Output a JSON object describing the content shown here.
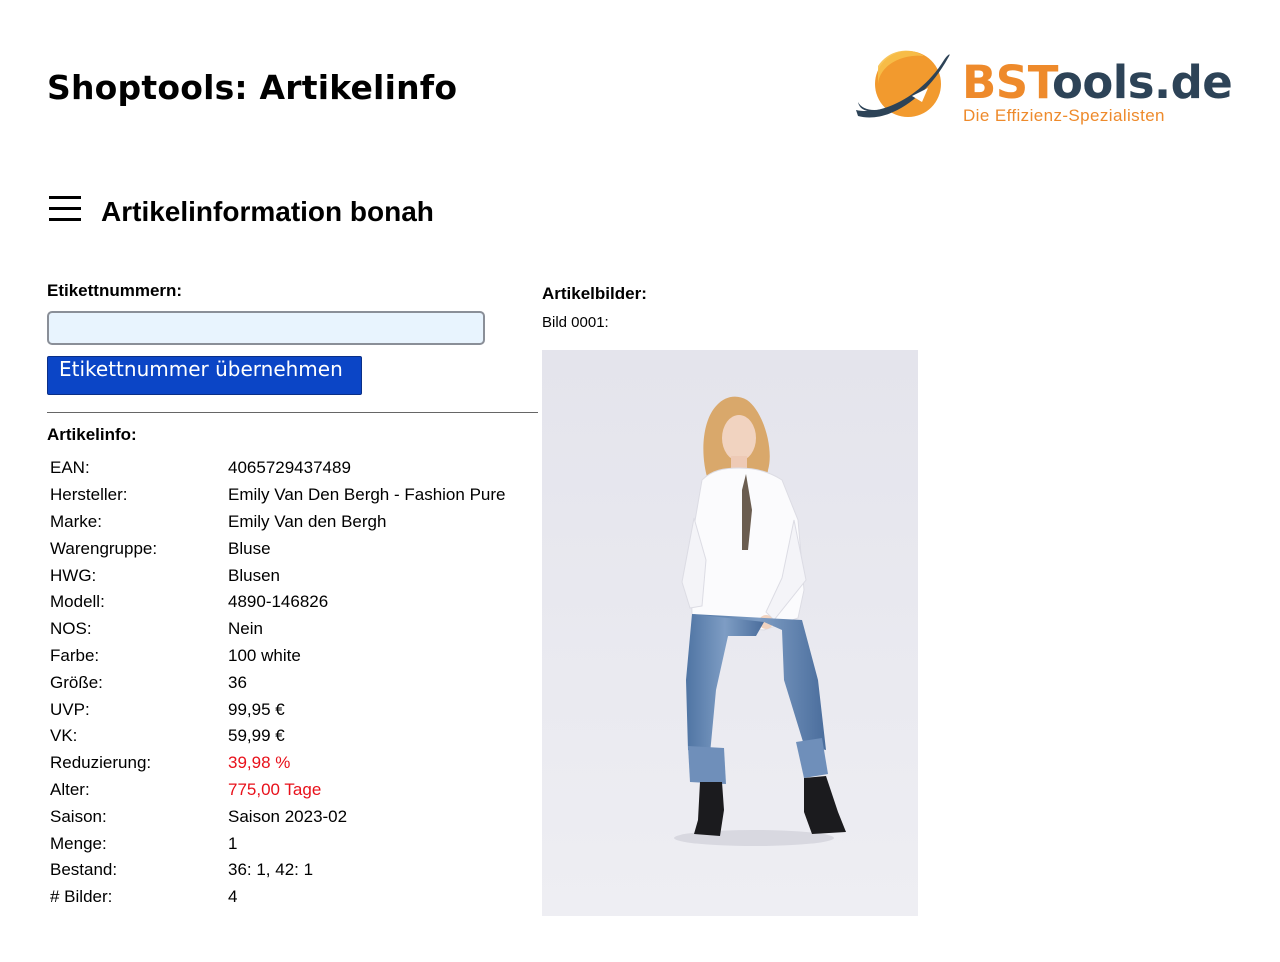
{
  "header": {
    "title": "Shoptools: Artikelinfo"
  },
  "logo": {
    "brand_highlight": "BST",
    "brand_rest": "ools.de",
    "tagline": "Die Effizienz-Spezialisten"
  },
  "section": {
    "title": "Artikelinformation bonah",
    "menu_icon": "hamburger-menu-icon"
  },
  "form": {
    "label": "Etikettnummern:",
    "value": "",
    "placeholder": "",
    "button_label": "Etikettnummer übernehmen ..."
  },
  "artikelinfo": {
    "label": "Artikelinfo:",
    "rows": [
      {
        "key": "EAN:",
        "value": "4065729437489"
      },
      {
        "key": "Hersteller:",
        "value": "Emily Van Den Bergh - Fashion Pure"
      },
      {
        "key": "Marke:",
        "value": "Emily Van den Bergh"
      },
      {
        "key": "Warengruppe:",
        "value": "Bluse"
      },
      {
        "key": "HWG:",
        "value": "Blusen"
      },
      {
        "key": "Modell:",
        "value": "4890-146826"
      },
      {
        "key": "NOS:",
        "value": "Nein"
      },
      {
        "key": "Farbe:",
        "value": "100 white"
      },
      {
        "key": "Größe:",
        "value": "36"
      },
      {
        "key": "UVP:",
        "value": "99,95 €"
      },
      {
        "key": "VK:",
        "value": "59,99 €"
      },
      {
        "key": "Reduzierung:",
        "value": "39,98 %",
        "highlight": true
      },
      {
        "key": "Alter:",
        "value": "775,00 Tage",
        "highlight": true
      },
      {
        "key": "Saison:",
        "value": "Saison 2023-02"
      },
      {
        "key": "Menge:",
        "value": "1"
      },
      {
        "key": "Bestand:",
        "value": "36: 1, 42: 1"
      },
      {
        "key": "# Bilder:",
        "value": "4"
      }
    ]
  },
  "bilder": {
    "label": "Artikelbilder:",
    "image_label": "Bild 0001:"
  },
  "colors": {
    "button": "#0b45c6",
    "highlight": "#e8101a",
    "input_bg": "#e8f4fe",
    "logo_orange": "#ee8a2b",
    "logo_navy": "#2d4357"
  }
}
